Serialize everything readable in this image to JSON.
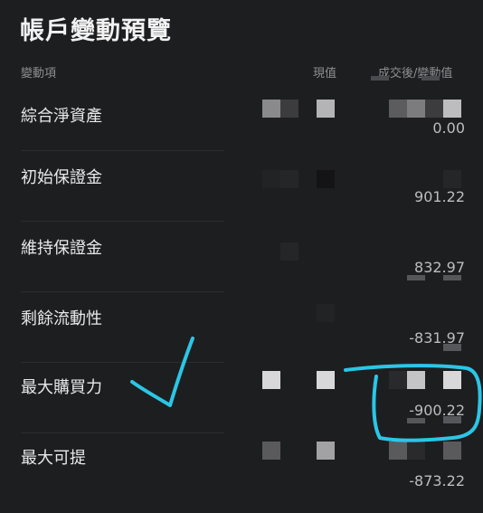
{
  "page": {
    "title": "帳戶變動預覽"
  },
  "header": {
    "item": "變動項",
    "current": "現值",
    "after": "成交後/變動值"
  },
  "rows": [
    {
      "label": "綜合淨資產",
      "value": "0.00"
    },
    {
      "label": "初始保證金",
      "value": "901.22"
    },
    {
      "label": "維持保證金",
      "value": "832.97"
    },
    {
      "label": "剩餘流動性",
      "value": "-831.97"
    },
    {
      "label": "最大購買力",
      "value": "-900.22"
    },
    {
      "label": "最大可提",
      "value": "-873.22"
    }
  ],
  "annotation": {
    "color": "#2bc6e6",
    "mark": "checkmark",
    "highlight": "circle"
  }
}
